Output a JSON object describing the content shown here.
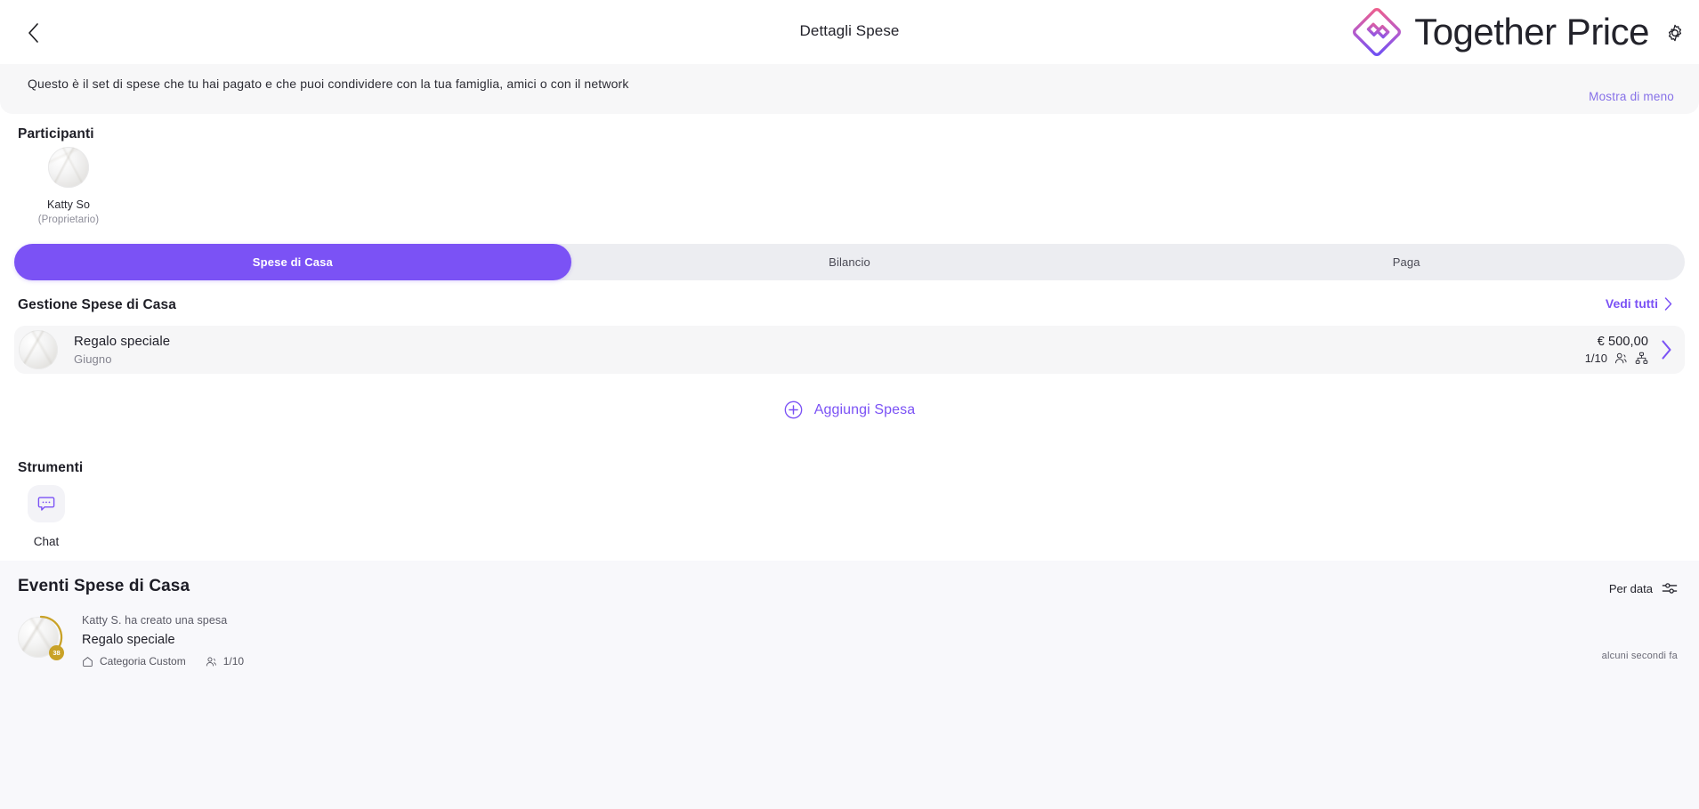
{
  "header": {
    "back_icon": "chevron-left-icon",
    "title": "Dettagli Spese",
    "brand_name": "Together Price",
    "brand_logo_icon": "together-price-diamond-logo",
    "settings_icon": "gear-icon",
    "brand_gradient_start": "#ef5f8c",
    "brand_gradient_end": "#7b52f5"
  },
  "description": {
    "text": "Questo è il set di spese che tu hai pagato e che puoi condividere con la tua famiglia, amici o con il network",
    "show_less_label": "Mostra di meno"
  },
  "participants": {
    "title": "Participanti",
    "items": [
      {
        "name": "Katty So",
        "role": "(Proprietario)",
        "avatar_icon": "user-avatar"
      }
    ]
  },
  "tabs": {
    "items": [
      {
        "label": "Spese di Casa",
        "active": true
      },
      {
        "label": "Bilancio",
        "active": false
      },
      {
        "label": "Paga",
        "active": false
      }
    ],
    "active_color": "#7b52f5",
    "track_color": "#ecedf1"
  },
  "expenses_section": {
    "title": "Gestione Spese di Casa",
    "see_all_label": "Vedi tutti",
    "see_all_icon": "chevron-right-icon",
    "rows": [
      {
        "avatar_icon": "expense-avatar",
        "title": "Regalo speciale",
        "subtitle": "Giugno",
        "price": "€ 500,00",
        "members": "1/10",
        "members_icon": "people-icon",
        "network_icon": "network-icon",
        "chevron_icon": "chevron-right-icon"
      }
    ],
    "add_label": "Aggiungi Spesa",
    "add_icon": "plus-circle-icon"
  },
  "tools": {
    "title": "Strumenti",
    "items": [
      {
        "label": "Chat",
        "icon": "chat-bubble-icon"
      }
    ]
  },
  "events": {
    "title": "Eventi Spese di Casa",
    "sort_label": "Per data",
    "sort_icon": "filter-sliders-icon",
    "items": [
      {
        "avatar_icon": "user-avatar",
        "badge_text": "38",
        "line1": "Katty S. ha creato una spesa",
        "line2": "Regalo speciale",
        "category_label": "Categoria Custom",
        "category_icon": "home-icon",
        "members": "1/10",
        "members_icon": "people-icon",
        "time": "alcuni secondi fa"
      }
    ]
  }
}
